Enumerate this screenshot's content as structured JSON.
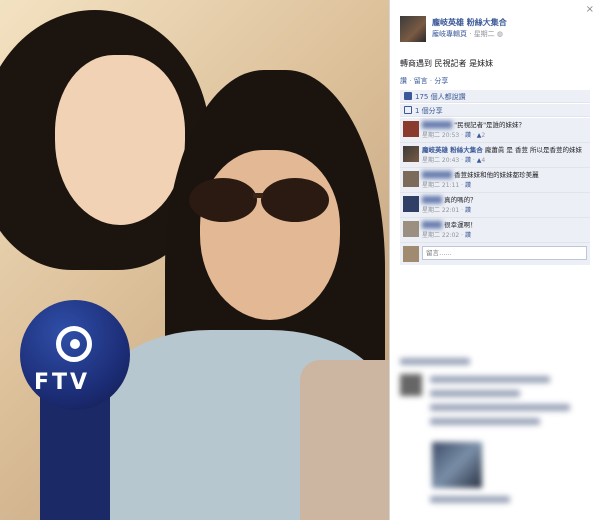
{
  "post": {
    "author": "龐岐英雄 粉絲大集合",
    "meta_link": "龐岐專輯頁",
    "meta_time": "星期二",
    "caption": "轉商遇到 民視記者 是妹妹",
    "actions": [
      "讚",
      "留言",
      "分享"
    ],
    "likes": "175 個人都說讚",
    "shares": "1 個分享",
    "close_symbol": "×"
  },
  "comments": [
    {
      "name": "",
      "text": "\"民視記者\"是誰的妹妹？",
      "time": "星期二 20:53",
      "likes": "2"
    },
    {
      "name": "龐岐英雄 粉絲大集合",
      "text": "龐蕭眞 是 香荳 所以是香荳的妹妹",
      "time": "星期二 20:43",
      "likes": "4"
    },
    {
      "name": "",
      "text": "香荳妹妹和他的妹妹都珍美麗",
      "time": "星期二 21:11",
      "likes": ""
    },
    {
      "name": "",
      "text": "真的嗎的？",
      "time": "星期二 22:01",
      "likes": ""
    },
    {
      "name": "",
      "text": "很幸運啊！",
      "time": "星期二 22:02",
      "likes": ""
    }
  ],
  "comment_input": {
    "placeholder": "留言……"
  },
  "photo": {
    "mic_label": "FTV"
  }
}
